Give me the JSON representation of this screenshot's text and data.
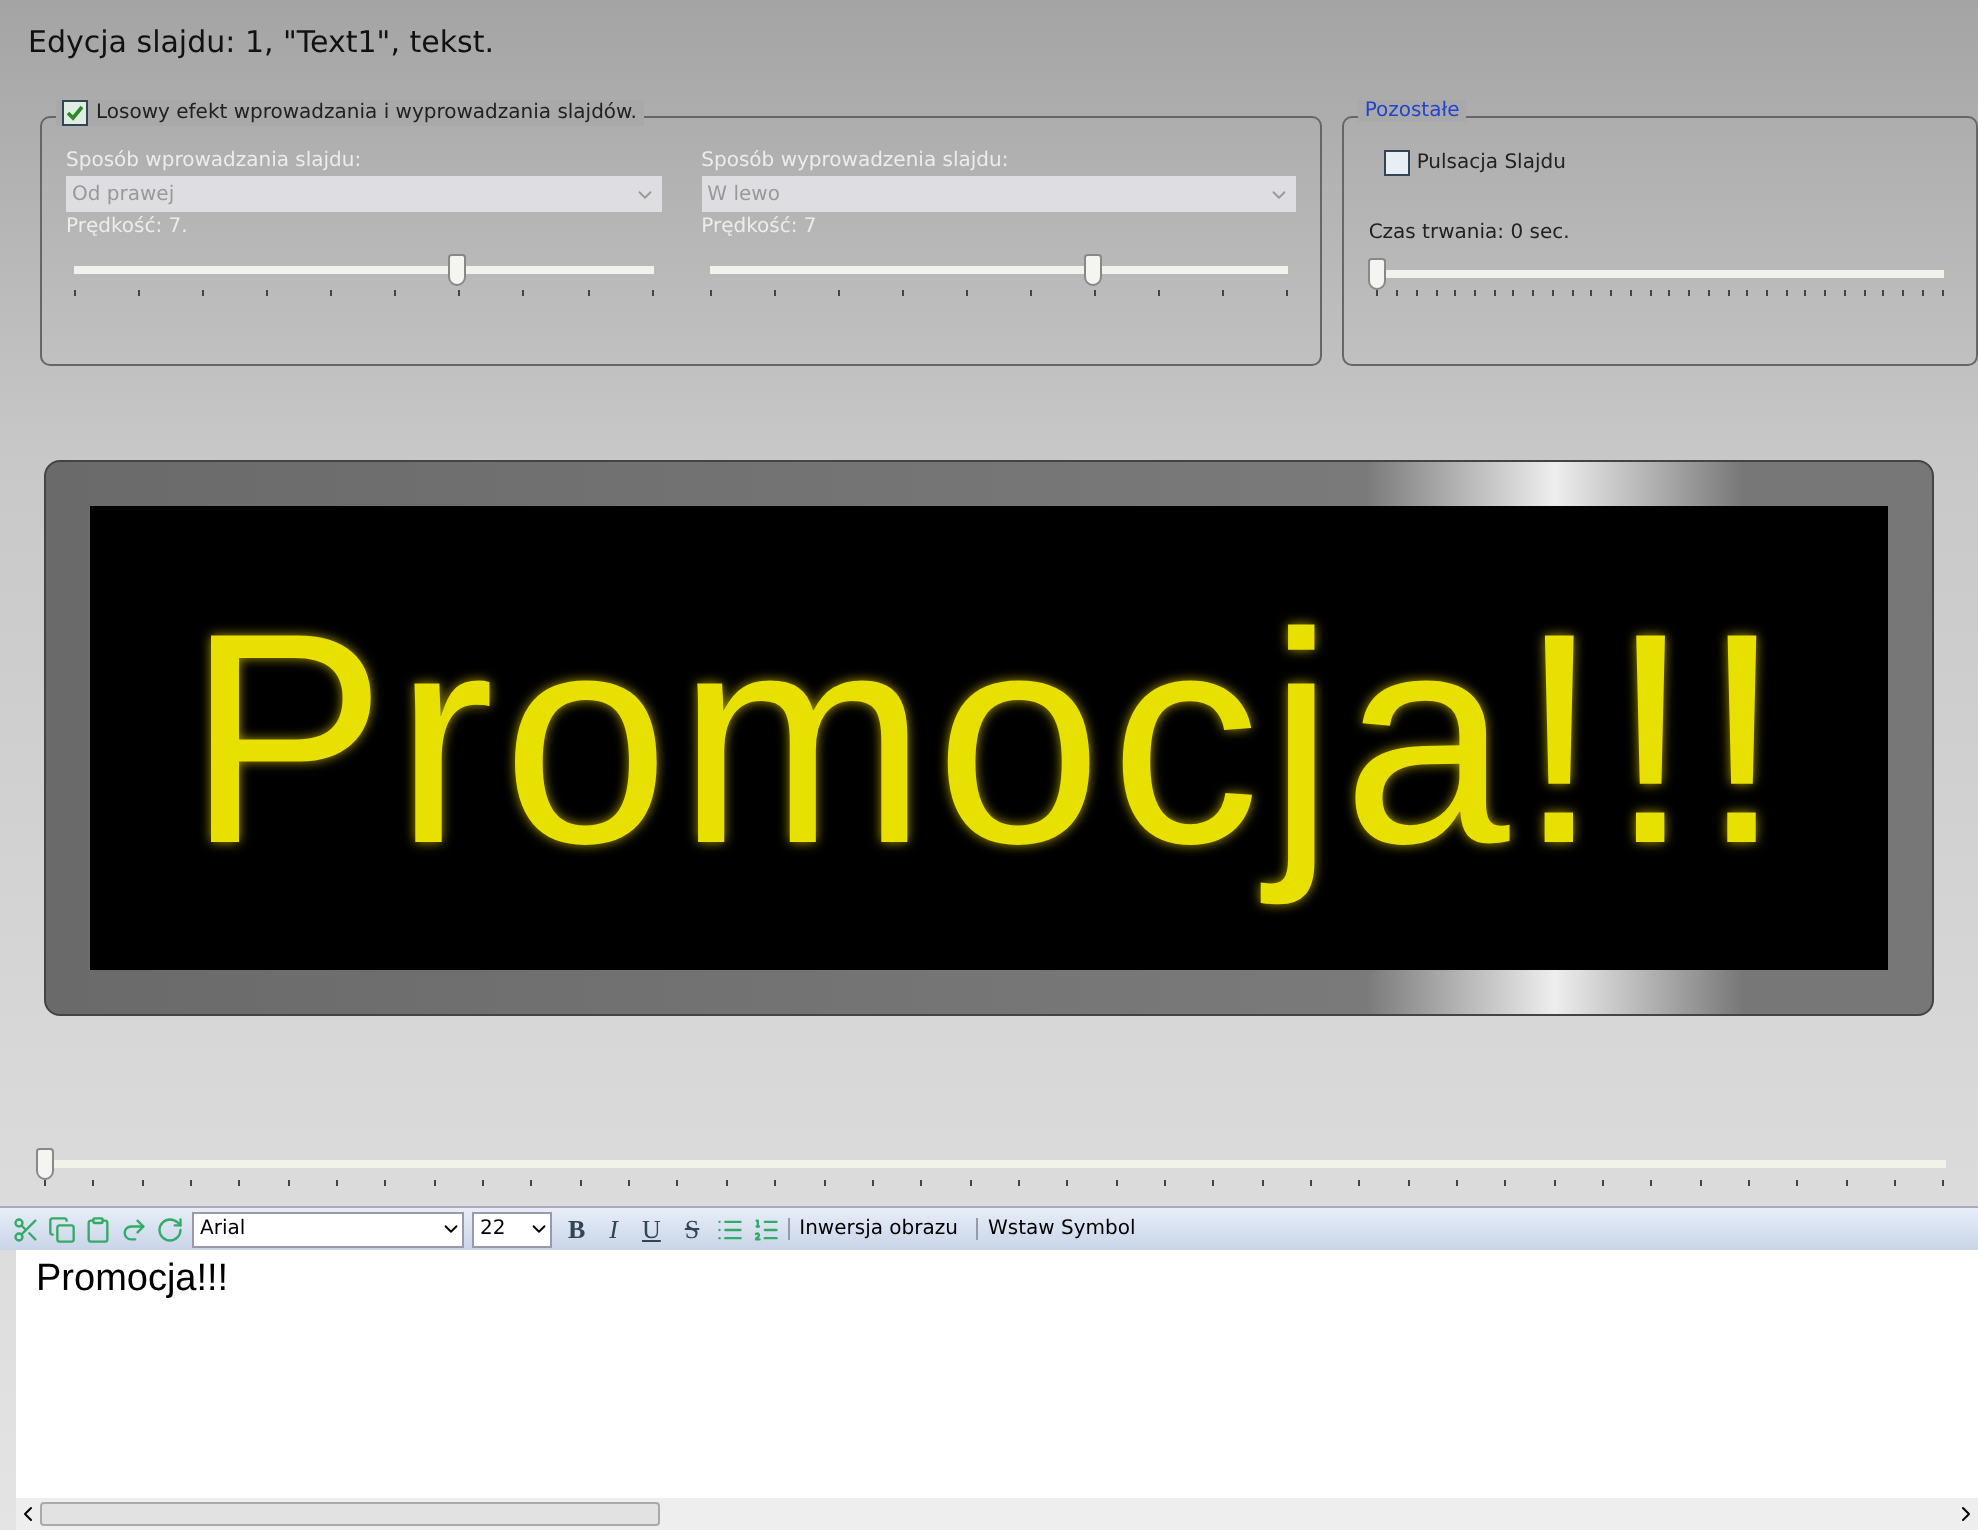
{
  "title": "Edycja slajdu: 1, \"Text1\", tekst.",
  "effects": {
    "label": "Losowy efekt wprowadzania i wyprowadzania slajdów.",
    "checked": true,
    "columns": [
      {
        "label": "Sposób wprowadzania slajdu:",
        "value": "Od prawej",
        "speed_label": "Prędkość: 7.",
        "level": 0.66
      },
      {
        "label": "Sposób wyprowadzenia slajdu:",
        "value": "W lewo",
        "speed_label": "Prędkość: 7",
        "level": 0.66
      }
    ]
  },
  "other": {
    "legend": "Pozostałe",
    "pulse": {
      "label": "Pulsacja Slajdu",
      "checked": false
    },
    "duration_label": "Czas trwania: 0 sec.",
    "level": 0
  },
  "display": {
    "text": "Promocja!!!"
  },
  "timeline": {
    "level": 0
  },
  "toolbar": {
    "font": "Arial",
    "size": "22",
    "bold": "B",
    "italic": "I",
    "underline": "U",
    "strike": "S",
    "buttons": [
      "Inwersja obrazu",
      "Wstaw Symbol"
    ]
  },
  "editor": {
    "value": "Promocja!!!"
  }
}
